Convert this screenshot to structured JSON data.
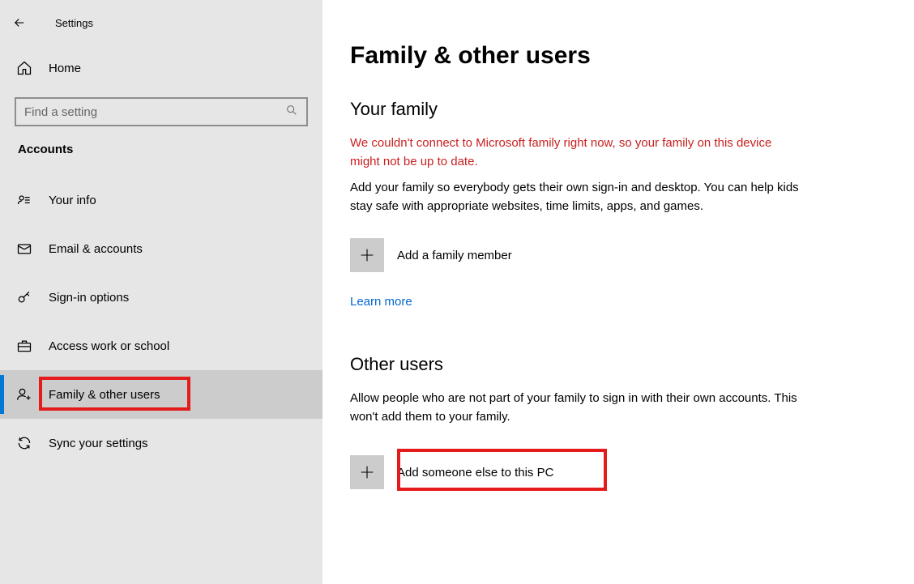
{
  "header": {
    "app_title": "Settings"
  },
  "sidebar": {
    "home_label": "Home",
    "search_placeholder": "Find a setting",
    "section_label": "Accounts",
    "items": [
      {
        "label": "Your info"
      },
      {
        "label": "Email & accounts"
      },
      {
        "label": "Sign-in options"
      },
      {
        "label": "Access work or school"
      },
      {
        "label": "Family & other users"
      },
      {
        "label": "Sync your settings"
      }
    ]
  },
  "main": {
    "page_title": "Family & other users",
    "family": {
      "heading": "Your family",
      "error": "We couldn't connect to Microsoft family right now, so your family on this device might not be up to date.",
      "body": "Add your family so everybody gets their own sign-in and desktop. You can help kids stay safe with appropriate websites, time limits, apps, and games.",
      "add_label": "Add a family member",
      "learn_more": "Learn more"
    },
    "others": {
      "heading": "Other users",
      "body": "Allow people who are not part of your family to sign in with their own accounts. This won't add them to your family.",
      "add_label": "Add someone else to this PC"
    }
  }
}
